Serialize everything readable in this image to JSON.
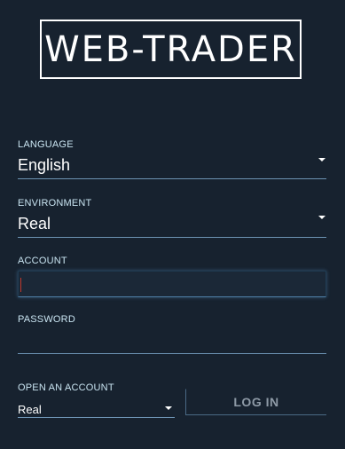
{
  "brand": {
    "logo_text": "WEB-TRADER"
  },
  "form": {
    "language": {
      "label": "LANGUAGE",
      "value": "English",
      "icon": "chevron-down-icon"
    },
    "environment": {
      "label": "ENVIRONMENT",
      "value": "Real",
      "icon": "chevron-down-icon"
    },
    "account": {
      "label": "ACCOUNT",
      "value": ""
    },
    "password": {
      "label": "PASSWORD",
      "value": ""
    }
  },
  "footer": {
    "open_account": {
      "label": "OPEN AN ACCOUNT",
      "value": "Real",
      "icon": "chevron-down-icon"
    },
    "login_label": "LOG IN"
  },
  "colors": {
    "background": "#17222f",
    "field_line": "#6d93b3",
    "label_text": "#c9e4f1",
    "login_text": "#8e9aa6",
    "cursor": "#c0392b"
  }
}
